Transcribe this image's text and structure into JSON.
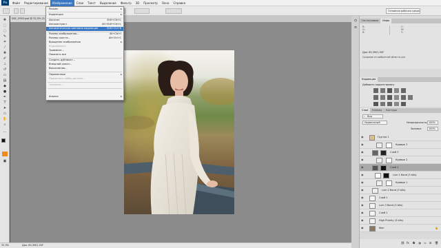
{
  "menubar": {
    "logo": "Ps",
    "items": [
      "Файл",
      "Редактирование",
      "Изображение",
      "Слои",
      "Текст",
      "Выделение",
      "Фильтр",
      "3D",
      "Просмотр",
      "Окно",
      "Справка"
    ]
  },
  "options": {
    "workspace": "Основная рабочая среда"
  },
  "document": {
    "tab": "DSC_5903.psd @ 32,5% (Слой 1, RGB/8)",
    "status_zoom": "32,9%",
    "status_doc": "Док: 60,3M/1,50F"
  },
  "image_menu": {
    "items": [
      {
        "label": "Режим",
        "submenu": true
      },
      {
        "label": "Коррекция",
        "submenu": true
      },
      {
        "label": "Автотон",
        "shortcut": "Shift+Ctrl+L"
      },
      {
        "label": "Автоконтраст",
        "shortcut": "Alt+Shift+Ctrl+L"
      },
      {
        "label": "Автоматическая цветовая коррекция",
        "shortcut": "Shift+Ctrl+B",
        "highlight": true
      },
      {
        "label": "Размер изображения...",
        "shortcut": "Alt+Ctrl+I"
      },
      {
        "label": "Размер холста...",
        "shortcut": "Alt+Ctrl+C"
      },
      {
        "label": "Вращение изображения",
        "submenu": true
      },
      {
        "label": "Кадрировать",
        "disabled": true
      },
      {
        "label": "Тримминг...",
        "disabled": false
      },
      {
        "label": "Показать все",
        "disabled": false
      },
      {
        "label": "Создать дубликат..."
      },
      {
        "label": "Внешний канал..."
      },
      {
        "label": "Вычисления..."
      },
      {
        "label": "Переменные",
        "submenu": true
      },
      {
        "label": "Применить набор данных...",
        "disabled": true
      },
      {
        "label": "Треппинг...",
        "disabled": true
      },
      {
        "label": "Анализ",
        "submenu": true
      }
    ]
  },
  "panels": {
    "top_tabs": [
      "Гистограмма",
      "Инфо"
    ],
    "info_doc": "Док: 60,3M/1,50F",
    "info_hint": "Создание из выбранной области для",
    "adjust_tabs": [
      "Коррекция"
    ],
    "adjust_title": "Добавить корректировку",
    "layers_tabs": [
      "Слои",
      "Каналы",
      "Контуры"
    ],
    "layers_kind": "Вид",
    "blend_mode": "Нормальный",
    "opacity_label": "Непрозрачность:",
    "opacity": "100%",
    "fill_label": "Заливка:",
    "fill": "100%",
    "layers": [
      {
        "name": "Группа 1",
        "type": "group"
      },
      {
        "name": "Кривые 3",
        "type": "curves"
      },
      {
        "name": "Слой 3",
        "type": "mask"
      },
      {
        "name": "Кривые 2",
        "type": "curves"
      },
      {
        "name": "Слой 2",
        "type": "mask",
        "selected": true
      },
      {
        "name": "Lum 1 Band (3 bits)",
        "type": "mask"
      },
      {
        "name": "Кривые 1",
        "type": "curves"
      },
      {
        "name": "Lum 2 Band (3 bits)",
        "type": "curves"
      },
      {
        "name": "Слой 1",
        "type": "plain"
      },
      {
        "name": "Lum 3 Band (3 bits)",
        "type": "plain"
      },
      {
        "name": "Слой 1",
        "type": "plain"
      },
      {
        "name": "High Priority (3 bits)",
        "type": "plain"
      },
      {
        "name": "Фон",
        "type": "photo"
      }
    ]
  },
  "colors": {
    "accent": "#3a78c4",
    "canvas_bg": "#8b8b8b",
    "panel_bg": "#e3e3e3"
  }
}
